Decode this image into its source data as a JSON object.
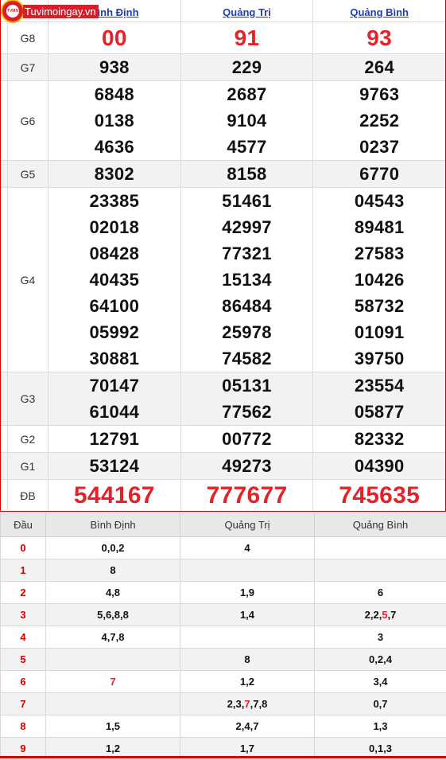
{
  "logo": {
    "text": "Tuvimoingay.vn",
    "badge_text": "TVMN"
  },
  "provinces": [
    "Bình Định",
    "Quảng Trị",
    "Quảng Bình"
  ],
  "prizes": [
    {
      "label": "G8",
      "values": [
        [
          "00"
        ],
        [
          "91"
        ],
        [
          "93"
        ]
      ]
    },
    {
      "label": "G7",
      "values": [
        [
          "938"
        ],
        [
          "229"
        ],
        [
          "264"
        ]
      ]
    },
    {
      "label": "G6",
      "values": [
        [
          "6848",
          "0138",
          "4636"
        ],
        [
          "2687",
          "9104",
          "4577"
        ],
        [
          "9763",
          "2252",
          "0237"
        ]
      ]
    },
    {
      "label": "G5",
      "values": [
        [
          "8302"
        ],
        [
          "8158"
        ],
        [
          "6770"
        ]
      ]
    },
    {
      "label": "G4",
      "values": [
        [
          "23385",
          "02018",
          "08428",
          "40435",
          "64100",
          "05992",
          "30881"
        ],
        [
          "51461",
          "42997",
          "77321",
          "15134",
          "86484",
          "25978",
          "74582"
        ],
        [
          "04543",
          "89481",
          "27583",
          "10426",
          "58732",
          "01091",
          "39750"
        ]
      ]
    },
    {
      "label": "G3",
      "values": [
        [
          "70147",
          "61044"
        ],
        [
          "05131",
          "77562"
        ],
        [
          "23554",
          "05877"
        ]
      ]
    },
    {
      "label": "G2",
      "values": [
        [
          "12791"
        ],
        [
          "00772"
        ],
        [
          "82332"
        ]
      ]
    },
    {
      "label": "G1",
      "values": [
        [
          "53124"
        ],
        [
          "49273"
        ],
        [
          "04390"
        ]
      ]
    },
    {
      "label": "ĐB",
      "values": [
        [
          "544167"
        ],
        [
          "777677"
        ],
        [
          "745635"
        ]
      ]
    }
  ],
  "tail_table": {
    "header": [
      "Đầu",
      "Bình Định",
      "Quảng Trị",
      "Quảng Bình"
    ],
    "rows": [
      {
        "head": "0",
        "cells": [
          "0,0,2",
          "4",
          ""
        ]
      },
      {
        "head": "1",
        "cells": [
          "8",
          "",
          ""
        ]
      },
      {
        "head": "2",
        "cells": [
          "4,8",
          "1,9",
          "6"
        ]
      },
      {
        "head": "3",
        "cells": [
          "5,6,8,8",
          "1,4",
          "2,2,5,7"
        ]
      },
      {
        "head": "4",
        "cells": [
          "4,7,8",
          "",
          "3"
        ]
      },
      {
        "head": "5",
        "cells": [
          "",
          "8",
          "0,2,4"
        ]
      },
      {
        "head": "6",
        "cells": [
          "7",
          "1,2",
          "3,4"
        ]
      },
      {
        "head": "7",
        "cells": [
          "",
          "2,3,7,7,8",
          "0,7"
        ]
      },
      {
        "head": "8",
        "cells": [
          "1,5",
          "2,4,7",
          "1,3"
        ]
      },
      {
        "head": "9",
        "cells": [
          "1,2",
          "1,7",
          "0,1,3"
        ]
      }
    ]
  },
  "colors": {
    "accent_red": "#e3232a",
    "link_blue": "#1e3fb3",
    "border_red": "#d40000"
  }
}
